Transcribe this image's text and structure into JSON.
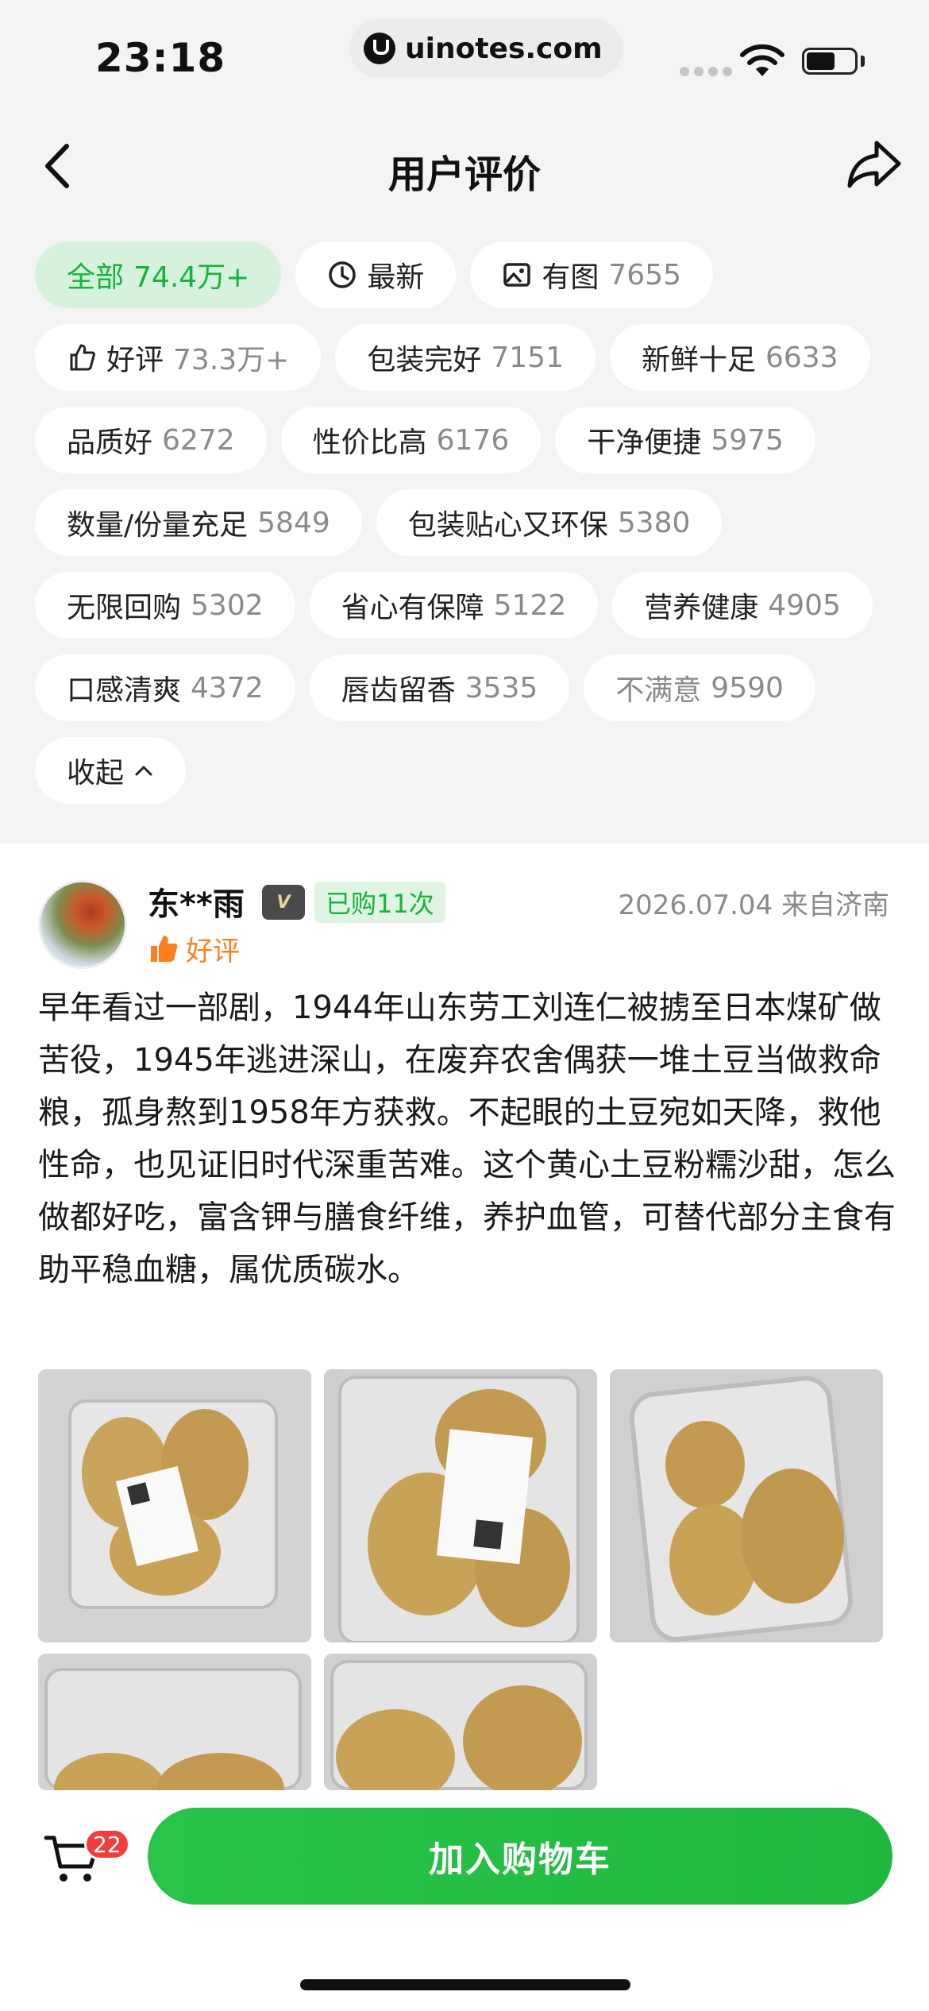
{
  "status_bar": {
    "time": "23:18",
    "url": "uinotes.com"
  },
  "header": {
    "title": "用户评价",
    "back_icon": "chevron-left-icon",
    "share_icon": "share-icon"
  },
  "tags": [
    {
      "label": "全部",
      "count": "74.4万+",
      "active": true,
      "icon": ""
    },
    {
      "label": "最新",
      "count": "",
      "icon": "clock-icon"
    },
    {
      "label": "有图",
      "count": "7655",
      "icon": "image-icon"
    },
    {
      "label": "好评",
      "count": "73.3万+",
      "icon": "thumbs-up-icon"
    },
    {
      "label": "包装完好",
      "count": "7151"
    },
    {
      "label": "新鲜十足",
      "count": "6633"
    },
    {
      "label": "品质好",
      "count": "6272"
    },
    {
      "label": "性价比高",
      "count": "6176"
    },
    {
      "label": "干净便捷",
      "count": "5975"
    },
    {
      "label": "数量/份量充足",
      "count": "5849"
    },
    {
      "label": "包装贴心又环保",
      "count": "5380"
    },
    {
      "label": "无限回购",
      "count": "5302"
    },
    {
      "label": "省心有保障",
      "count": "5122"
    },
    {
      "label": "营养健康",
      "count": "4905"
    },
    {
      "label": "口感清爽",
      "count": "4372"
    },
    {
      "label": "唇齿留香",
      "count": "3535"
    },
    {
      "label": "不满意",
      "count": "9590",
      "negative": true
    },
    {
      "label": "收起",
      "count": "",
      "icon": "chevron-up-icon"
    }
  ],
  "review": {
    "username": "东**雨",
    "vip_label": "V",
    "purchase_badge": "已购11次",
    "date": "2026.07.04",
    "location": "来自济南",
    "meta": "2026.07.04 来自济南",
    "rating_label": "好评",
    "text": "早年看过一部剧，1944年山东劳工刘连仁被掳至日本煤矿做苦役，1945年逃进深山，在废弃农舍偶获一堆土豆当做救命粮，孤身熬到1958年方获救。不起眼的土豆宛如天降，救他性命，也见证旧时代深重苦难。这个黄心土豆粉糯沙甜，怎么做都好吃，富含钾与膳食纤维，养护血管，可替代部分主食有助平稳血糖，属优质碳水。",
    "photo_count": 5
  },
  "bottom_bar": {
    "cart_count": "22",
    "add_to_cart_label": "加入购物车"
  },
  "colors": {
    "accent_green": "#1fb73e",
    "active_tag_bg": "#d6f2dc",
    "rating_orange": "#ff7f1e",
    "badge_red": "#f23d3d"
  }
}
